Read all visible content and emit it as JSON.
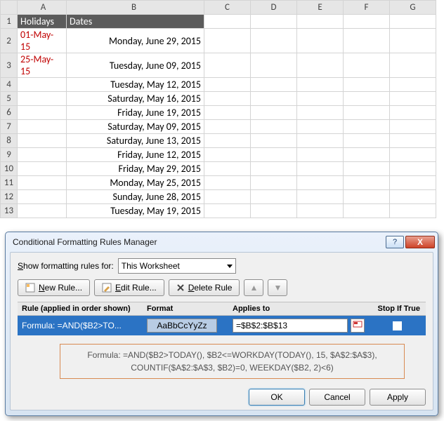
{
  "columns": [
    "A",
    "B",
    "C",
    "D",
    "E",
    "F",
    "G"
  ],
  "rows": [
    "1",
    "2",
    "3",
    "4",
    "5",
    "6",
    "7",
    "8",
    "9",
    "10",
    "11",
    "12",
    "13"
  ],
  "headers": {
    "A": "Holidays",
    "B": "Dates"
  },
  "holidays": [
    "01-May-15",
    "25-May-15"
  ],
  "dates": [
    {
      "text": "Monday, June 29, 2015",
      "hl": false
    },
    {
      "text": "Tuesday, June 09, 2015",
      "hl": false
    },
    {
      "text": "Tuesday, May 12, 2015",
      "hl": true
    },
    {
      "text": "Saturday, May 16, 2015",
      "hl": false
    },
    {
      "text": "Friday, June 19, 2015",
      "hl": false
    },
    {
      "text": "Saturday, May 09, 2015",
      "hl": false
    },
    {
      "text": "Saturday, June 13, 2015",
      "hl": false
    },
    {
      "text": "Friday, June 12, 2015",
      "hl": false
    },
    {
      "text": "Friday, May 29, 2015",
      "hl": true
    },
    {
      "text": "Monday, May 25, 2015",
      "hl": false
    },
    {
      "text": "Sunday, June 28, 2015",
      "hl": false
    },
    {
      "text": "Tuesday, May 19, 2015",
      "hl": true
    }
  ],
  "dialog": {
    "title": "Conditional Formatting Rules Manager",
    "show_label_pre": "S",
    "show_label_post": "how formatting rules for:",
    "scope": "This Worksheet",
    "buttons": {
      "new_pre": "N",
      "new_post": "ew Rule...",
      "edit_pre": "E",
      "edit_post": "dit Rule...",
      "delete_pre": "D",
      "delete_post": "elete Rule"
    },
    "list_headers": {
      "rule": "Rule (applied in order shown)",
      "format": "Format",
      "applies": "Applies to",
      "stop": "Stop If True"
    },
    "rule": {
      "name": "Formula: =AND($B2>TO...",
      "format_preview": "AaBbCcYyZz",
      "applies_to": "=$B$2:$B$13"
    },
    "formula_full_line1": "Formula: =AND($B2>TODAY(), $B2<=WORKDAY(TODAY(), 15, $A$2:$A$3),",
    "formula_full_line2": "COUNTIF($A$2:$A$3, $B2)=0, WEEKDAY($B2, 2)<6)",
    "footer": {
      "ok": "OK",
      "cancel": "Cancel",
      "apply": "Apply"
    },
    "help_glyph": "?",
    "close_glyph": "X"
  }
}
